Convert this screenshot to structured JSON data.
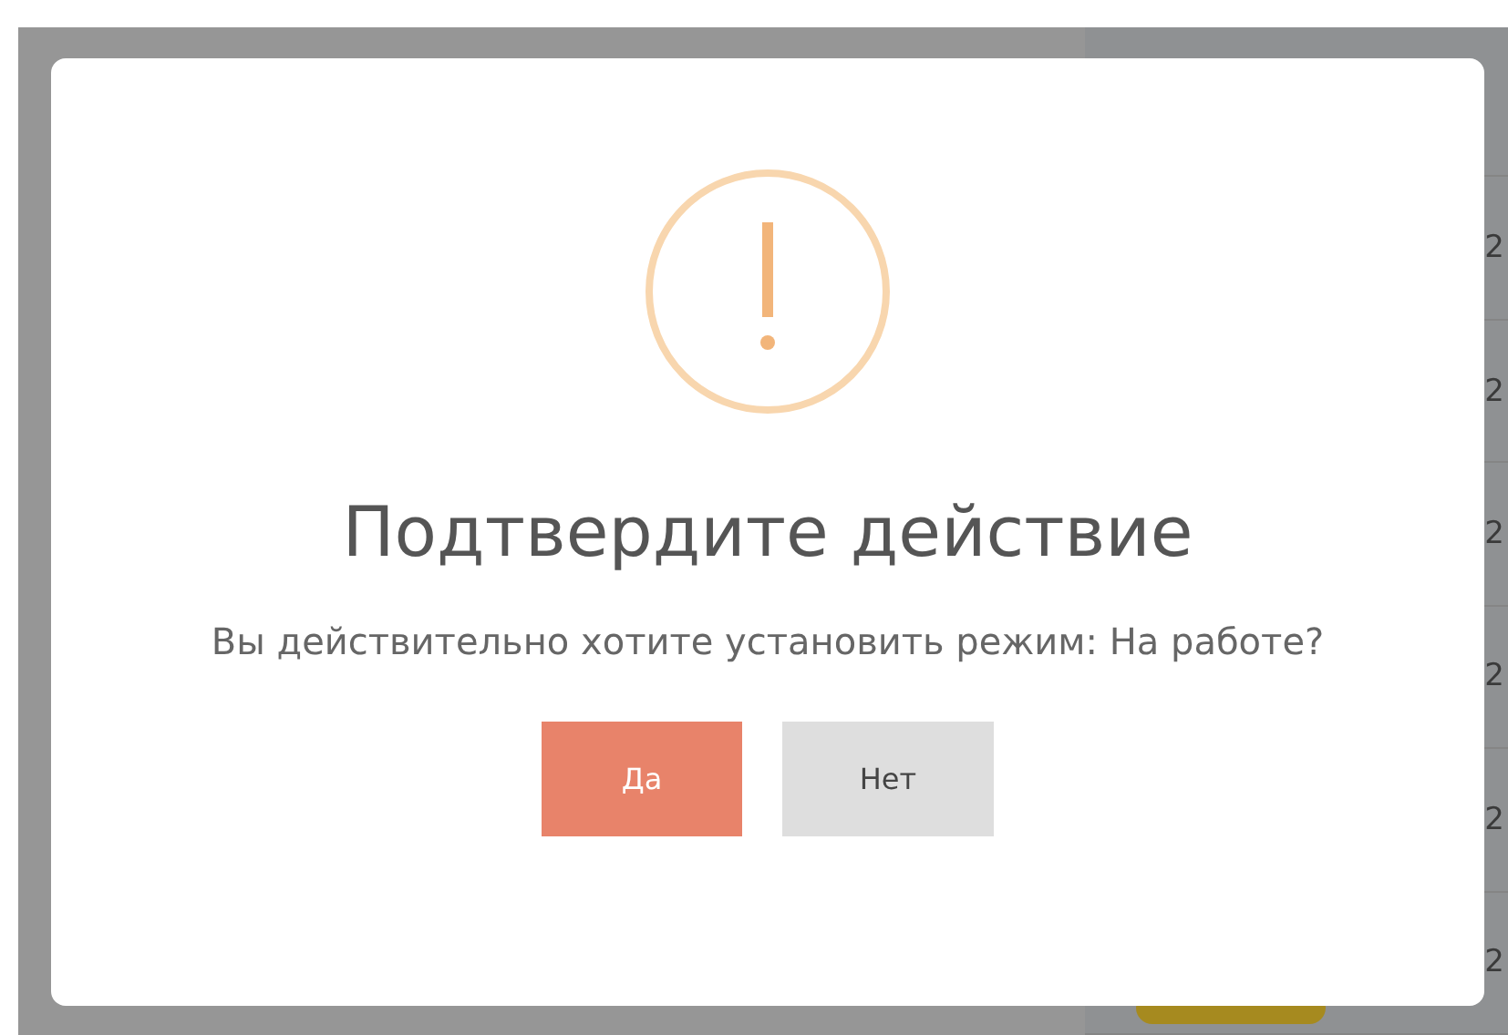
{
  "background": {
    "table": {
      "cells": [
        "2",
        "2",
        "2",
        "2",
        "2",
        "2"
      ]
    }
  },
  "dialog": {
    "title": "Подтвердите действие",
    "message": "Вы действительно хотите установить режим: На работе?",
    "buttons": [
      {
        "label": "Да",
        "kind": "primary"
      },
      {
        "label": "Нет",
        "kind": "secondary"
      }
    ]
  }
}
